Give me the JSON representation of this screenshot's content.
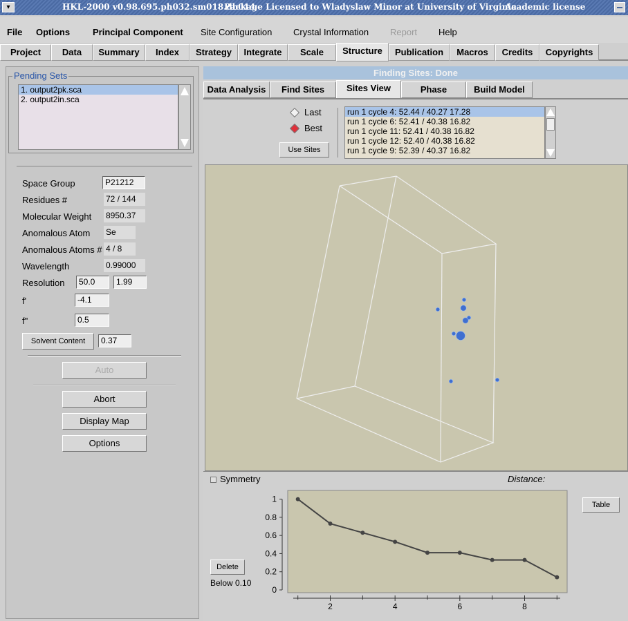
{
  "window": {
    "title_left": "HKL-2000 v0.98.695.ph032.sm018.db014",
    "title_mid": "Package Licensed to Wladyslaw Minor at University of Virginia",
    "title_right": "Academic license"
  },
  "menu": {
    "file": "File",
    "options": "Options",
    "principal_component": "Principal Component",
    "site_configuration": "Site Configuration",
    "crystal_information": "Crystal Information",
    "report": "Report",
    "help": "Help"
  },
  "main_tabs": [
    "Project",
    "Data",
    "Summary",
    "Index",
    "Strategy",
    "Integrate",
    "Scale",
    "Structure",
    "Publication",
    "Macros",
    "Credits",
    "Copyrights"
  ],
  "pending_sets": {
    "legend": "Pending Sets",
    "items": [
      "1. output2pk.sca",
      "2. output2in.sca"
    ]
  },
  "params": {
    "space_group_label": "Space Group",
    "space_group": "P21212",
    "residues_label": "Residues #",
    "residues": "72 / 144",
    "mw_label": "Molecular Weight",
    "mw": "8950.37",
    "anom_atom_label": "Anomalous Atom",
    "anom_atom": "Se",
    "anom_atoms_label": "Anomalous Atoms #",
    "anom_atoms": "4 / 8",
    "wavelength_label": "Wavelength",
    "wavelength": "0.99000",
    "resolution_label": "Resolution",
    "resolution_low": "50.0",
    "resolution_high": "1.99",
    "fprime_label": "f'",
    "fprime": "-4.1",
    "fdprime_label": "f\"",
    "fdprime": "0.5",
    "solvent_button": "Solvent Content",
    "solvent": "0.37"
  },
  "buttons": {
    "auto": "Auto",
    "abort": "Abort",
    "display_map": "Display Map",
    "options": "Options",
    "use_sites": "Use Sites",
    "delete": "Delete",
    "table": "Table"
  },
  "status": "Finding Sites: Done",
  "sub_tabs": [
    "Data Analysis",
    "Find Sites",
    "Sites View",
    "Phase",
    "Build Model"
  ],
  "radio": {
    "last": "Last",
    "best": "Best",
    "selected": "Best"
  },
  "runs": [
    "run 1 cycle 4:  52.44  /  40.27  17.28",
    "run 1 cycle 6:  52.41  /  40.38  16.82",
    "run 1 cycle 11:  52.41  /  40.38  16.82",
    "run 1 cycle 12:  52.40  /  40.38  16.82",
    "run 1 cycle 9:  52.39  /  40.37  16.82"
  ],
  "graph": {
    "symmetry_label": "Symmetry",
    "distance_label": "Distance:",
    "below_label": "Below  0.10"
  },
  "chart_data": {
    "type": "line",
    "x": [
      1,
      2,
      3,
      4,
      5,
      6,
      7,
      8,
      9
    ],
    "y": [
      1.0,
      0.73,
      0.63,
      0.53,
      0.41,
      0.41,
      0.33,
      0.33,
      0.14
    ],
    "xticks": [
      2,
      4,
      6,
      8
    ],
    "yticks": [
      "0",
      "0.2",
      "0.4",
      "0.6",
      "0.8",
      "1"
    ],
    "xlim": [
      0.9,
      9.1
    ],
    "ylim": [
      0,
      1.05
    ],
    "colors": {
      "line": "#444444",
      "background": "#c9c6ae"
    }
  },
  "viewer": {
    "sites": [
      {
        "id": "site-1",
        "size": "small"
      },
      {
        "id": "site-2",
        "size": "small"
      },
      {
        "id": "site-3",
        "size": "medium"
      },
      {
        "id": "site-4",
        "size": "small"
      },
      {
        "id": "site-5",
        "size": "medium"
      },
      {
        "id": "site-6",
        "size": "small"
      },
      {
        "id": "site-7",
        "size": "large"
      },
      {
        "id": "site-8",
        "size": "small"
      },
      {
        "id": "site-9",
        "size": "small"
      }
    ],
    "colors": {
      "site": "#3f6fd0",
      "box": "#eeeeee"
    }
  }
}
